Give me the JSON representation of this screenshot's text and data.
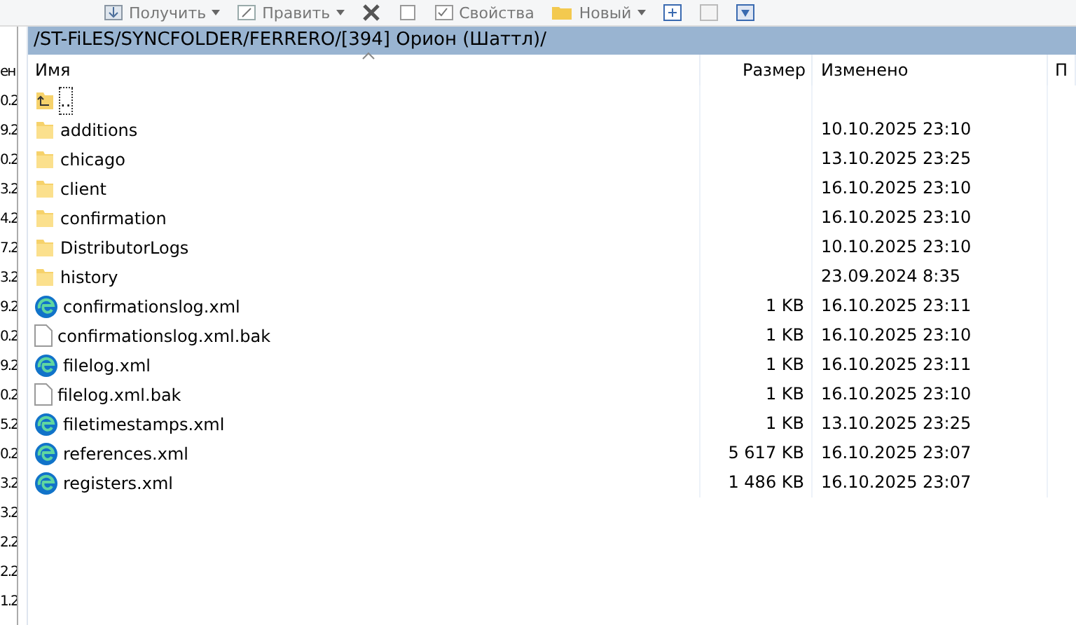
{
  "toolbar": [
    {
      "label": "Получить",
      "kind": "dropdown"
    },
    {
      "label": "Править",
      "kind": "dropdown"
    },
    {
      "kind": "icon"
    },
    {
      "kind": "icon"
    },
    {
      "label": "Свойства",
      "kind": "plain"
    },
    {
      "label": "Новый",
      "kind": "dropdown"
    },
    {
      "kind": "icon"
    },
    {
      "kind": "icon"
    },
    {
      "kind": "icon"
    }
  ],
  "left_pane": {
    "header": "ен",
    "cells": [
      "0.2",
      "9.2",
      "0.2",
      "3.2",
      "4.2",
      "7.2",
      "3.2",
      "9.2",
      "0.2",
      "9.2",
      "0.2",
      "5.2",
      "0.2",
      "3.2",
      "3.2",
      "2.2",
      "2.2",
      "1.2"
    ]
  },
  "path": "/ST-FiLES/SYNCFOLDER/FERRERO/[394] Орион (Шаттл)/",
  "table": {
    "columns": [
      "Имя",
      "Размер",
      "Изменено",
      "П"
    ],
    "rows": [
      {
        "kind": "parent",
        "name": ".."
      },
      {
        "kind": "folder",
        "name": "additions",
        "modified": "10.10.2025 23:10"
      },
      {
        "kind": "folder",
        "name": "chicago",
        "modified": "13.10.2025 23:25"
      },
      {
        "kind": "folder",
        "name": "client",
        "modified": "16.10.2025 23:10"
      },
      {
        "kind": "folder",
        "name": "confirmation",
        "modified": "16.10.2025 23:10"
      },
      {
        "kind": "folder",
        "name": "DistributorLogs",
        "modified": "10.10.2025 23:10"
      },
      {
        "kind": "folder",
        "name": "history",
        "modified": "23.09.2024 8:35"
      },
      {
        "kind": "xml",
        "name": "confirmationslog.xml",
        "size": "1 KB",
        "modified": "16.10.2025 23:11"
      },
      {
        "kind": "file",
        "name": "confirmationslog.xml.bak",
        "size": "1 KB",
        "modified": "16.10.2025 23:10"
      },
      {
        "kind": "xml",
        "name": "filelog.xml",
        "size": "1 KB",
        "modified": "16.10.2025 23:11"
      },
      {
        "kind": "file",
        "name": "filelog.xml.bak",
        "size": "1 KB",
        "modified": "16.10.2025 23:10"
      },
      {
        "kind": "xml",
        "name": "filetimestamps.xml",
        "size": "1 KB",
        "modified": "13.10.2025 23:25"
      },
      {
        "kind": "xml",
        "name": "references.xml",
        "size": "5 617 KB",
        "modified": "16.10.2025 23:07"
      },
      {
        "kind": "xml",
        "name": "registers.xml",
        "size": "1 486 KB",
        "modified": "16.10.2025 23:07"
      }
    ]
  }
}
